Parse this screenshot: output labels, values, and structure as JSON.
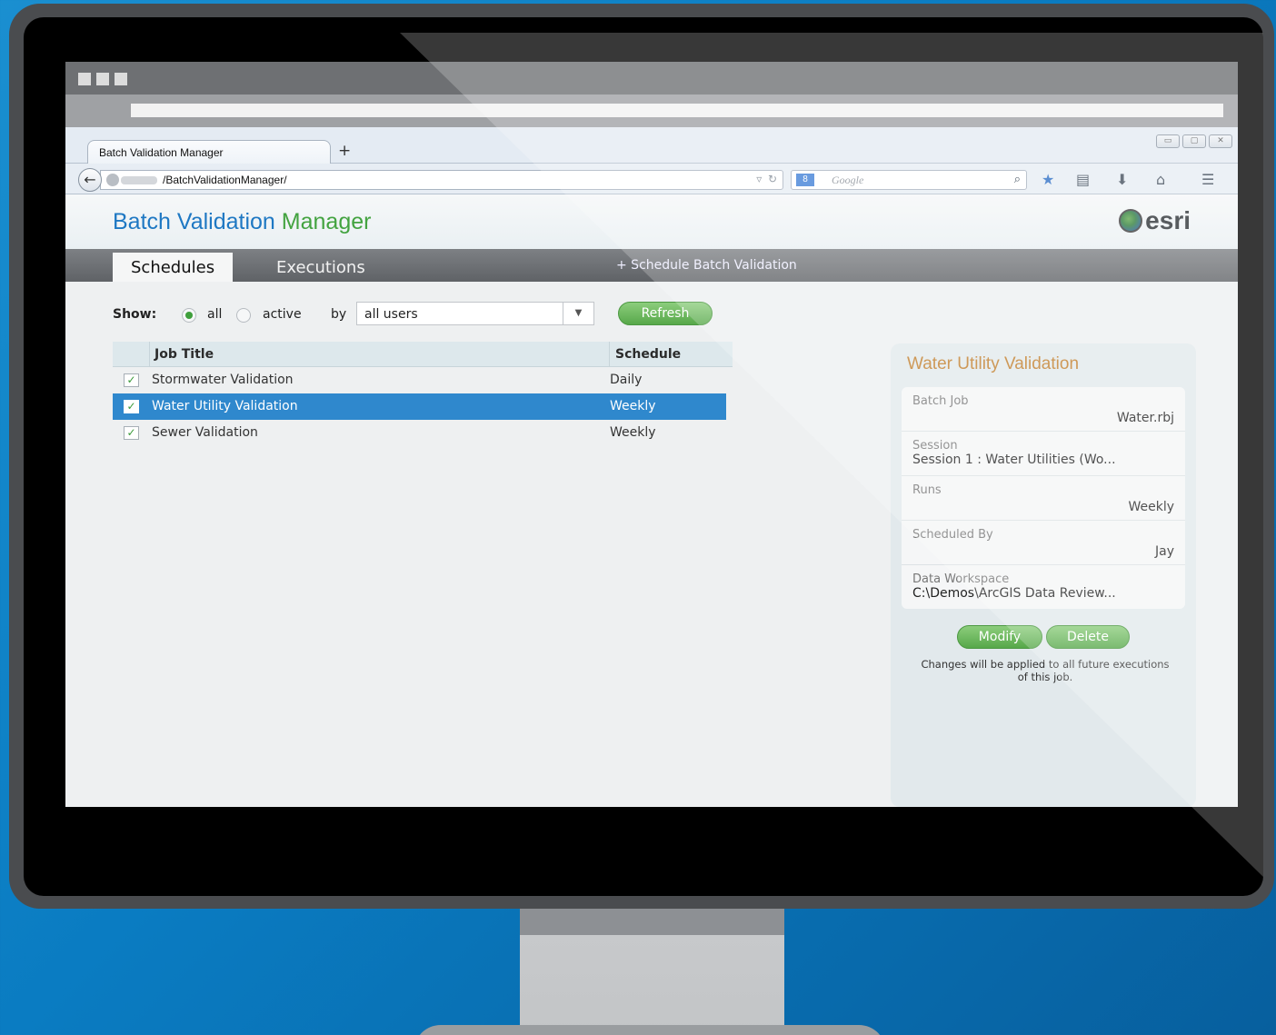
{
  "browser": {
    "tab_title": "Batch Validation Manager",
    "new_tab": "+",
    "url": "/BatchValidationManager/",
    "search_placeholder": "Google",
    "search_engine_badge": "8"
  },
  "app": {
    "title_part1": "Batch Validation ",
    "title_part2": "Manager",
    "logo_text": "esri",
    "tabs": [
      {
        "label": "Schedules",
        "active": true
      },
      {
        "label": "Executions",
        "active": false
      }
    ],
    "schedule_action": "+ Schedule Batch Validation"
  },
  "filters": {
    "show_label": "Show:",
    "option_all": "all",
    "option_active": "active",
    "by_label": "by",
    "user_select": "all users",
    "refresh_label": "Refresh"
  },
  "grid": {
    "headers": [
      "Job Title",
      "Schedule"
    ],
    "rows": [
      {
        "title": "Stormwater Validation",
        "schedule": "Daily",
        "selected": false
      },
      {
        "title": "Water Utility Validation",
        "schedule": "Weekly",
        "selected": true
      },
      {
        "title": "Sewer Validation",
        "schedule": "Weekly",
        "selected": false
      }
    ]
  },
  "details": {
    "title": "Water Utility Validation",
    "fields": [
      {
        "label": "Batch Job",
        "value": "Water.rbj"
      },
      {
        "label": "Session",
        "value": "Session 1 : Water Utilities (Wo..."
      },
      {
        "label": "Runs",
        "value": "Weekly"
      },
      {
        "label": "Scheduled By",
        "value": "Jay"
      },
      {
        "label": "Data Workspace",
        "value": "C:\\Demos\\ArcGIS Data Review..."
      }
    ],
    "modify_label": "Modify",
    "delete_label": "Delete",
    "note": "Changes will be applied to all future executions of this job."
  },
  "colors": {
    "accent_blue": "#1e78c3",
    "accent_green": "#43a340",
    "selection": "#2f88cd",
    "panel_title": "#c17d2a",
    "background": "#0a7cc2"
  }
}
